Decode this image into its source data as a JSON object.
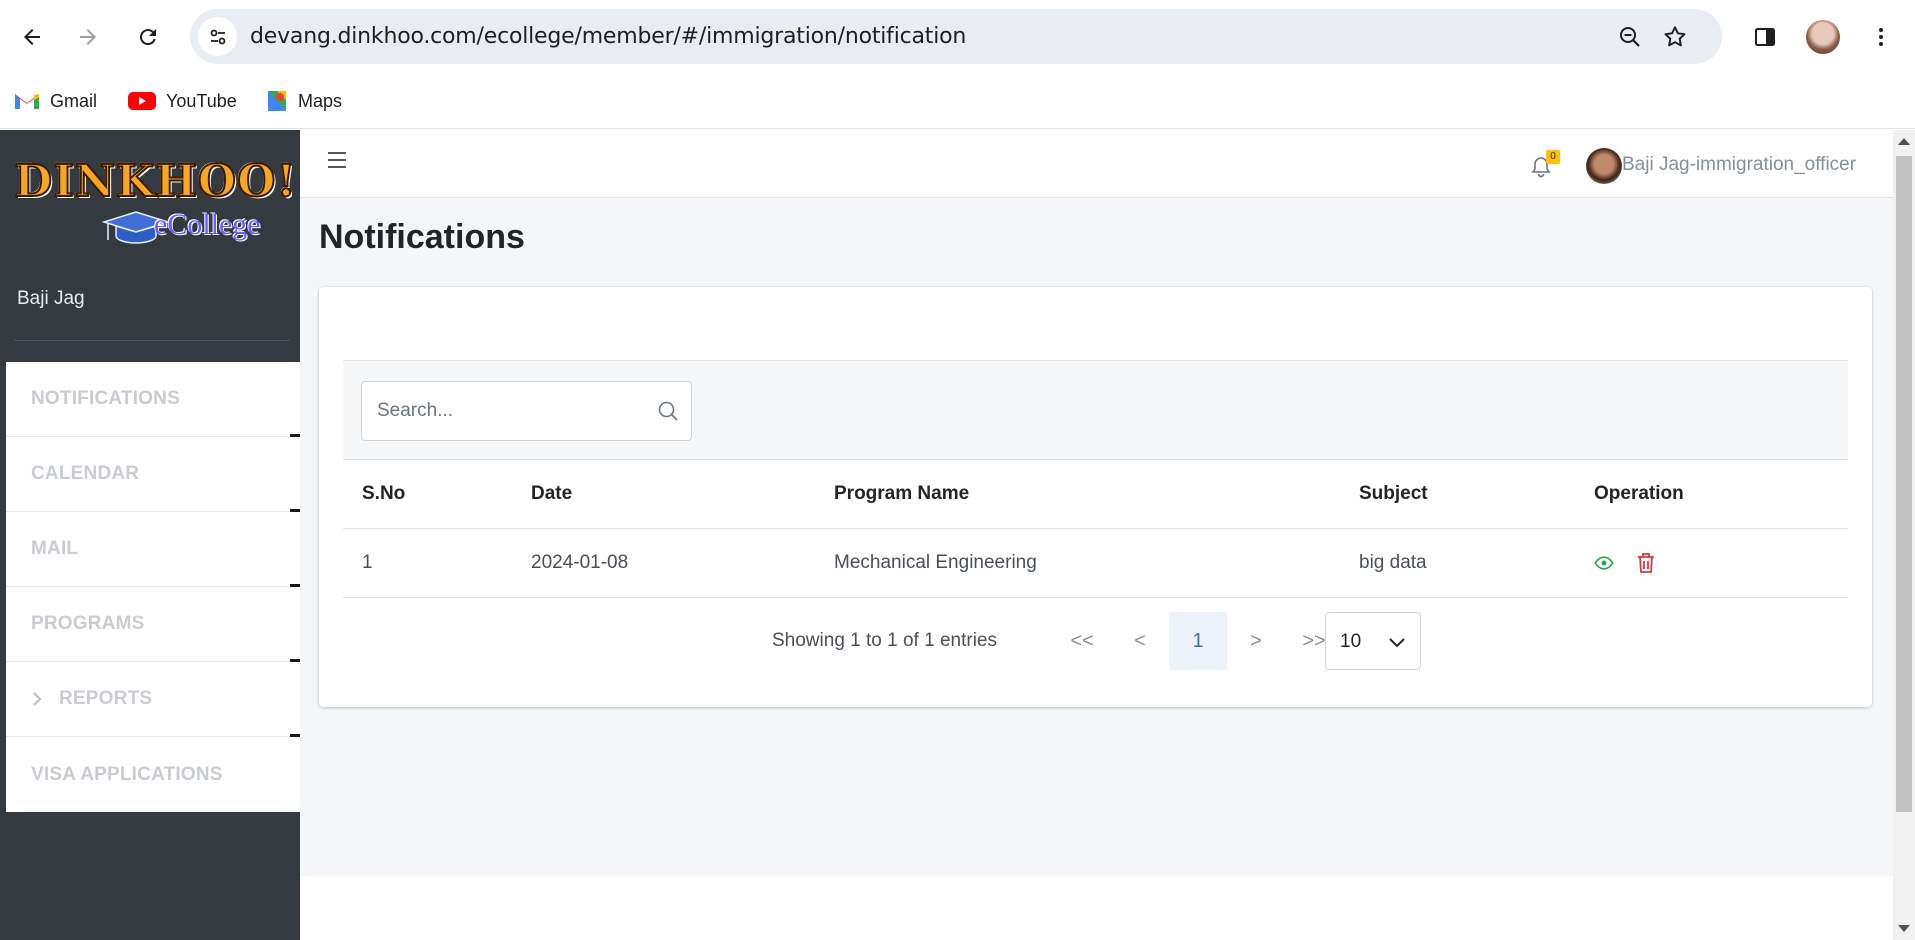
{
  "browser": {
    "url": "devang.dinkhoo.com/ecollege/member/#/immigration/notification",
    "bookmarks": [
      "Gmail",
      "YouTube",
      "Maps"
    ]
  },
  "sidebar": {
    "logo_text": "DINKHOO!",
    "logo_subtext": "eCollege",
    "user_name": "Baji Jag",
    "items": [
      {
        "label": "NOTIFICATIONS"
      },
      {
        "label": "CALENDAR"
      },
      {
        "label": "MAIL"
      },
      {
        "label": "PROGRAMS"
      },
      {
        "label": "REPORTS"
      },
      {
        "label": "VISA APPLICATIONS"
      }
    ]
  },
  "header": {
    "notification_count": "0",
    "user_role": "Baji Jag-immigration_officer"
  },
  "page": {
    "title": "Notifications"
  },
  "search": {
    "placeholder": "Search..."
  },
  "table": {
    "columns": [
      "S.No",
      "Date",
      "Program Name",
      "Subject",
      "Operation"
    ],
    "rows": [
      {
        "sno": "1",
        "date": "2024-01-08",
        "program": "Mechanical Engineering",
        "subject": "big data"
      }
    ]
  },
  "pagination": {
    "info": "Showing 1 to 1 of 1 entries",
    "first": "<<",
    "prev": "<",
    "current": "1",
    "next": ">",
    "last": ">>",
    "per_page": "10"
  },
  "colors": {
    "sidebar_bg": "#343a40",
    "view_icon": "#28a745",
    "delete_icon": "#dc3545",
    "badge": "#ffc107"
  }
}
